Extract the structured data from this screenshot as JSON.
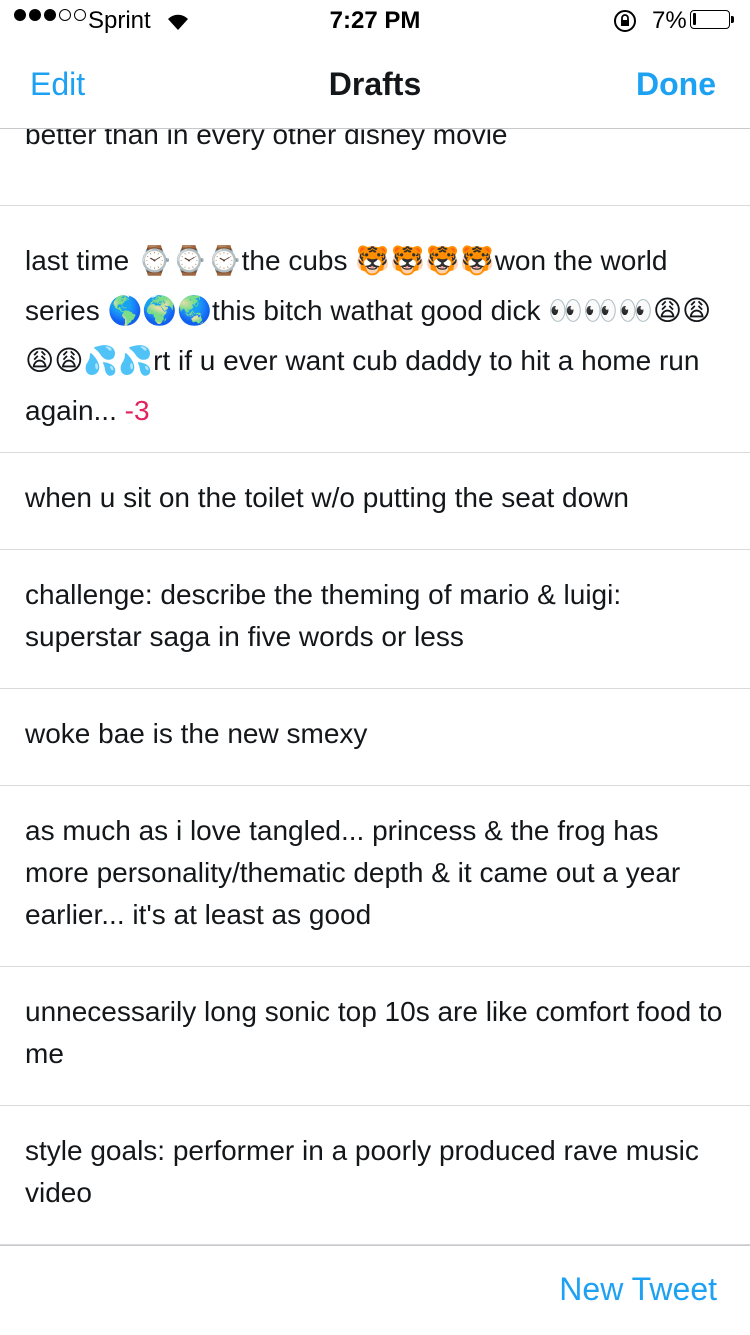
{
  "status_bar": {
    "carrier": "Sprint",
    "time": "7:27 PM",
    "battery_percent": "7%",
    "signal_bars_filled": 3,
    "signal_bars_total": 5,
    "icons": [
      "wifi-icon",
      "rotation-lock-icon",
      "battery-icon"
    ]
  },
  "nav": {
    "edit_label": "Edit",
    "title": "Drafts",
    "done_label": "Done"
  },
  "drafts": [
    {
      "text": "better than in every other disney movie"
    },
    {
      "text": "last time ⌚⌚⌚the cubs 🐯🐯🐯🐯won the world series 🌎🌍🌏this bitch wathat good dick 👀👀👀😩😩😩😩💦💦rt if u ever want cub daddy to hit a home run again...",
      "count": "-3"
    },
    {
      "text": "when u sit on the toilet w/o putting the seat down"
    },
    {
      "text": "challenge: describe the theming of mario & luigi: superstar saga in five words or less"
    },
    {
      "text": "woke bae is the new smexy"
    },
    {
      "text": "as much as i love tangled... princess & the frog has more personality/thematic depth & it came out a year earlier... it's at least as good"
    },
    {
      "text": "unnecessarily long sonic top 10s are like comfort food to me"
    },
    {
      "text": "style goals: performer in a poorly produced rave music video"
    }
  ],
  "bottom": {
    "new_tweet_label": "New Tweet"
  },
  "colors": {
    "accent": "#1da1f2",
    "count_negative": "#e0245e",
    "separator": "#d9d9de"
  }
}
